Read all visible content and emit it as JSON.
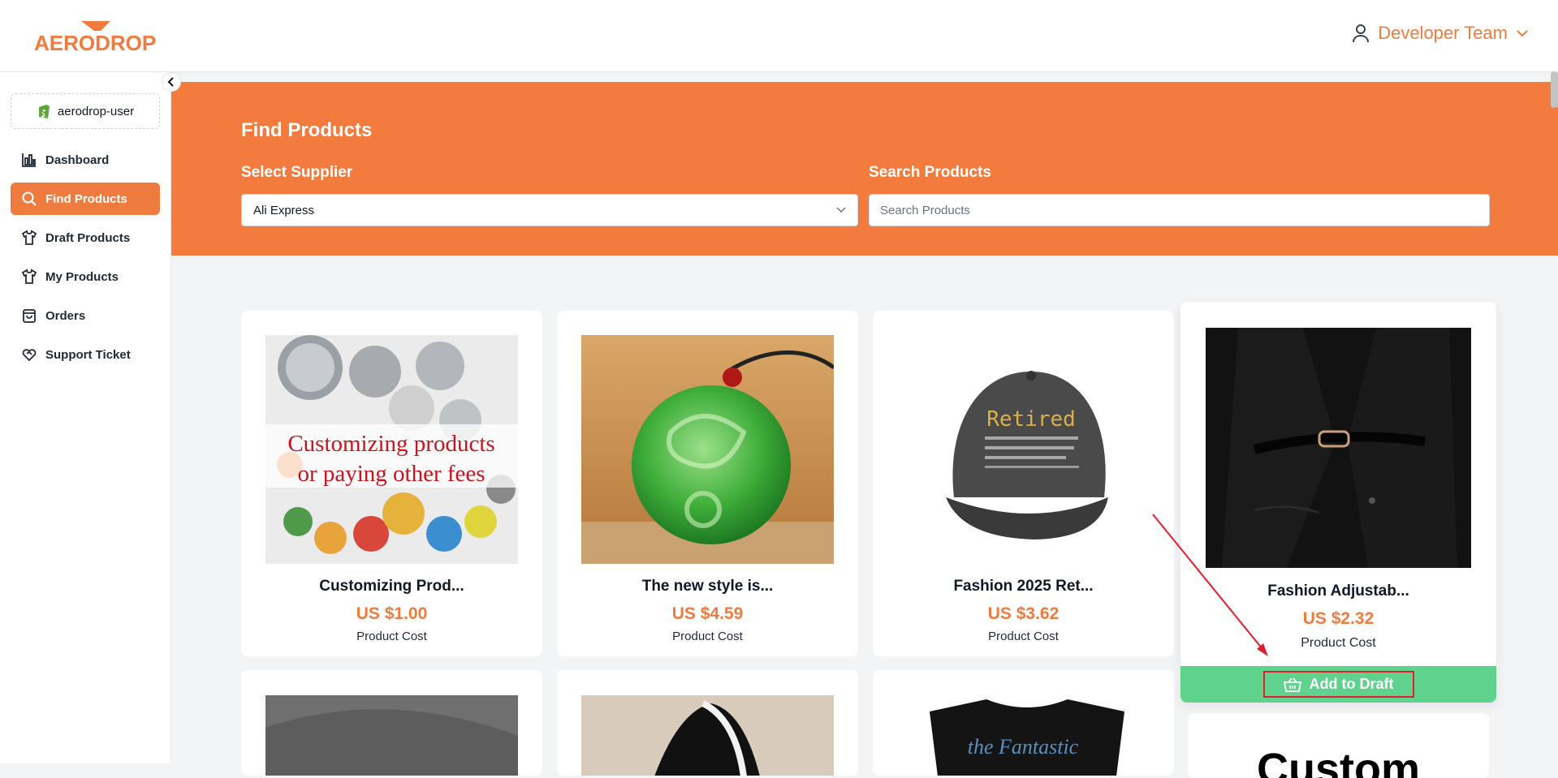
{
  "brand": {
    "logo_text": "AERODROP",
    "accent": "#f07b3f"
  },
  "header": {
    "user_name": "Developer Team"
  },
  "sidebar": {
    "store_name": "aerodrop-user",
    "items": [
      {
        "label": "Dashboard",
        "icon": "bar-chart-icon",
        "active": false
      },
      {
        "label": "Find Products",
        "icon": "search-icon",
        "active": true
      },
      {
        "label": "Draft Products",
        "icon": "shirt-icon",
        "active": false
      },
      {
        "label": "My Products",
        "icon": "shirt-icon",
        "active": false
      },
      {
        "label": "Orders",
        "icon": "bag-icon",
        "active": false
      },
      {
        "label": "Support Ticket",
        "icon": "heart-handshake-icon",
        "active": false
      }
    ]
  },
  "banner": {
    "title": "Find Products",
    "supplier_label": "Select Supplier",
    "supplier_value": "Ali Express",
    "search_label": "Search Products",
    "search_placeholder": "Search Products"
  },
  "products": [
    {
      "title": "Customizing Prod...",
      "price": "US $1.00",
      "cost_label": "Product Cost",
      "image_text_1": "Customizing products",
      "image_text_2": "or paying other fees"
    },
    {
      "title": "The new style is...",
      "price": "US $4.59",
      "cost_label": "Product Cost"
    },
    {
      "title": "Fashion 2025 Ret...",
      "price": "US $3.62",
      "cost_label": "Product Cost",
      "cap_text": "Retired"
    },
    {
      "title": "Fashion Adjustab...",
      "price": "US $2.32",
      "cost_label": "Product Cost",
      "button": "Add to Draft"
    }
  ],
  "partial_row": {
    "shirt_text": "the Fantastic",
    "card_text": "Custom"
  }
}
